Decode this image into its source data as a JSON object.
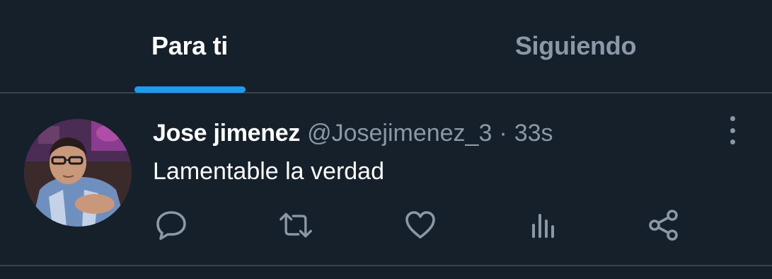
{
  "tabs": {
    "for_you": "Para ti",
    "following": "Siguiendo",
    "active": "for_you"
  },
  "tweet": {
    "display_name": "Jose jimenez",
    "handle": "@Josejimenez_3",
    "separator": "·",
    "time": "33s",
    "text": "Lamentable la verdad",
    "actions": [
      "reply-icon",
      "retweet-icon",
      "like-icon",
      "views-icon",
      "share-icon"
    ]
  },
  "colors": {
    "background": "#15202b",
    "divider": "#38444d",
    "accent": "#1d9bf0",
    "text_primary": "#ffffff",
    "text_secondary": "#8b98a5"
  }
}
